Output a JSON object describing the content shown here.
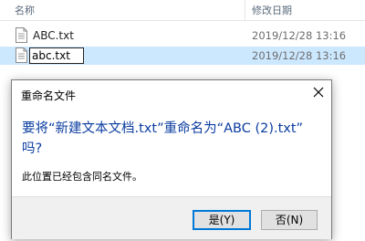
{
  "columns": {
    "name": "名称",
    "date_modified": "修改日期"
  },
  "files": [
    {
      "name": "ABC.txt",
      "modified": "2019/12/28 13:16",
      "icon": "text-file-icon"
    },
    {
      "name": "abc.txt",
      "modified": "2019/12/28 13:16",
      "icon": "text-file-icon",
      "renaming": true,
      "selected": true
    }
  ],
  "dialog": {
    "title": "重命名文件",
    "message_line1": "要将“新建文本文档.txt”重命名为“ABC (2).txt”",
    "message_line2": "吗?",
    "detail": "此位置已经包含同名文件。",
    "yes_label": "是(Y)",
    "no_label": "否(N)"
  },
  "colors": {
    "selection": "#cce8ff",
    "message_text": "#0b3da0",
    "default_button_border": "#0078d7"
  }
}
